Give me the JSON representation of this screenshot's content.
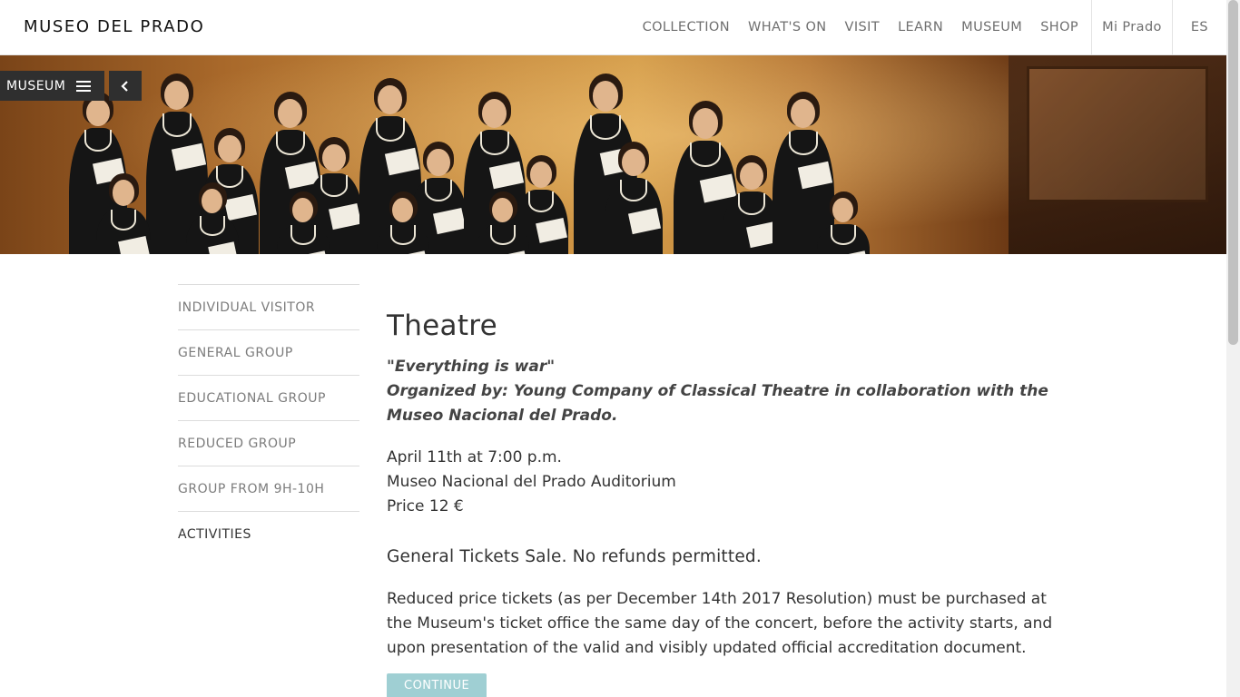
{
  "header": {
    "logo": "MUSEO DEL PRADO",
    "nav": {
      "collection": "COLLECTION",
      "whats_on": "WHAT'S ON",
      "visit": "VISIT",
      "learn": "LEARN",
      "museum": "MUSEUM",
      "shop": "SHOP",
      "mi_prado": "Mi Prado",
      "lang": "ES"
    }
  },
  "hero": {
    "menu_label": "MUSEUM",
    "menu_icon": "hamburger-icon",
    "back_icon": "chevron-left-icon"
  },
  "sidebar": {
    "items": [
      {
        "label": "INDIVIDUAL VISITOR"
      },
      {
        "label": "GENERAL GROUP"
      },
      {
        "label": "EDUCATIONAL GROUP"
      },
      {
        "label": "REDUCED GROUP"
      },
      {
        "label": "GROUP FROM 9H-10H"
      },
      {
        "label": "ACTIVITIES"
      }
    ]
  },
  "main": {
    "title": "Theatre",
    "subtitle_line1": "\"Everything is war\"",
    "subtitle_line2": "Organized by: Young Company of Classical Theatre in collaboration with the Museo Nacional del Prado.",
    "date": "April 11th at 7:00 p.m.",
    "location": "Museo Nacional del Prado Auditorium",
    "price": "Price 12 €",
    "notice": "General Tickets Sale. No refunds permitted.",
    "paragraph": "Reduced price tickets (as per December 14th 2017 Resolution) must be purchased at the Museum's ticket office the same day of the concert, before the activity starts, and upon presentation of the valid and visibly updated official accreditation document.",
    "continue_label": "CONTINUE"
  },
  "colors": {
    "accent_button": "#9fcfd3",
    "dark_button": "#2f2f2f"
  }
}
